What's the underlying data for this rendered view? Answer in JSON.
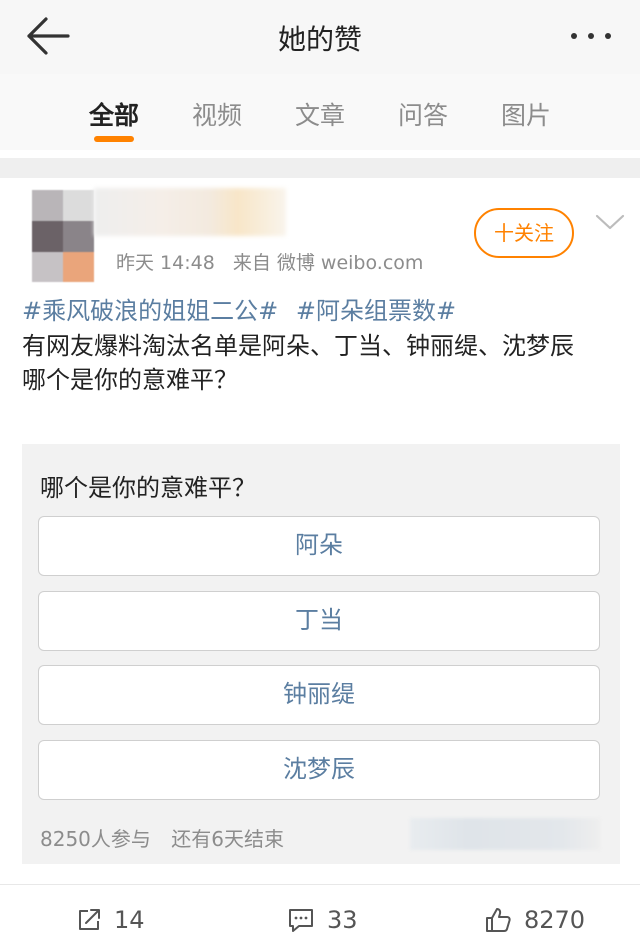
{
  "header": {
    "title": "她的赞",
    "back_icon": "back-arrow-icon",
    "more_icon": "more-dots-icon"
  },
  "tabs": [
    {
      "label": "全部",
      "active": true
    },
    {
      "label": "视频",
      "active": false
    },
    {
      "label": "文章",
      "active": false
    },
    {
      "label": "问答",
      "active": false
    },
    {
      "label": "图片",
      "active": false
    }
  ],
  "post": {
    "follow_label": "十关注",
    "time": "昨天 14:48",
    "source": "来自 微博 weibo.com",
    "hashtags": [
      "#乘风破浪的姐姐二公#",
      "#阿朵组票数#"
    ],
    "text": "有网友爆料淘汰名单是阿朵、丁当、钟丽缇、沈梦辰\n哪个是你的意难平？",
    "poll": {
      "question": "哪个是你的意难平？",
      "options": [
        "阿朵",
        "丁当",
        "钟丽缇",
        "沈梦辰"
      ],
      "participants": "8250人参与",
      "remaining": "还有6天结束"
    },
    "actions": {
      "reposts": "14",
      "comments": "33",
      "likes": "8270"
    }
  },
  "colors": {
    "accent": "#ff8200",
    "link": "#5b7ea1"
  }
}
